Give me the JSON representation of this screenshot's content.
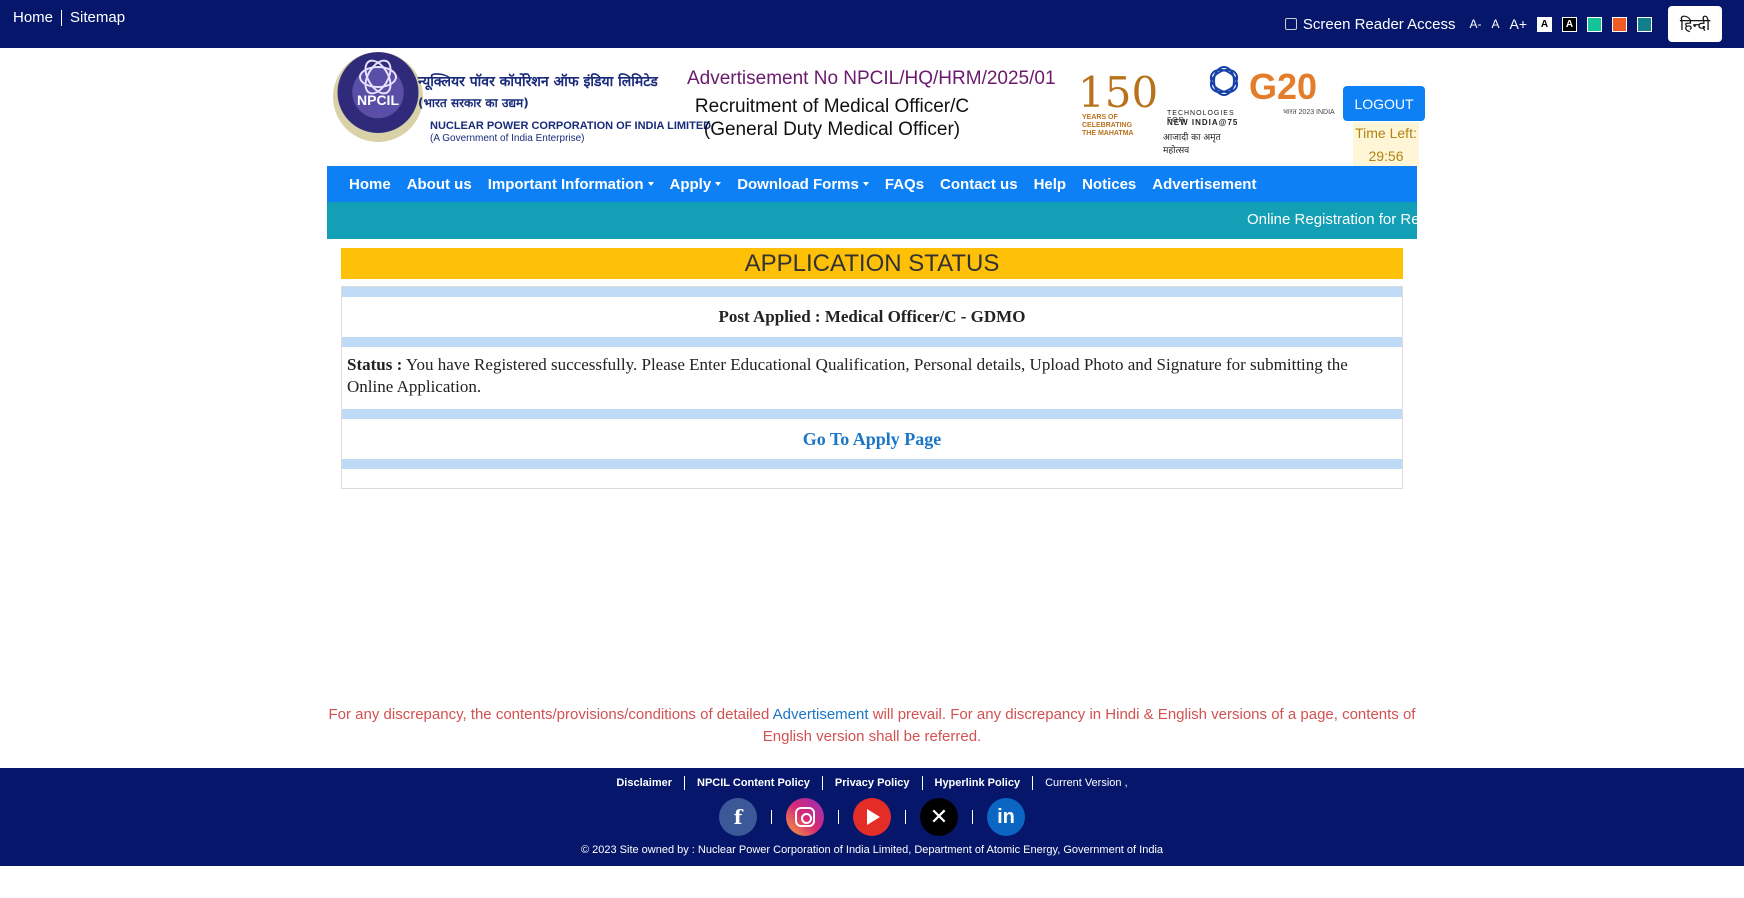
{
  "topbar": {
    "home": "Home",
    "sitemap": "Sitemap",
    "screen_reader": "Screen Reader Access",
    "font_decrease": "A-",
    "font_normal": "A",
    "font_increase": "A+",
    "contrast_white": "A",
    "contrast_black": "A",
    "theme_colors": [
      "#15c39a",
      "#f15a24",
      "#137f8c"
    ],
    "language": "हिन्दी"
  },
  "header": {
    "org_hindi": "न्यूक्लियर पॉवर कॉर्पोरेशन ऑफ इंडिया लिमिटेड",
    "org_hindi_sub": "(भारत सरकार का उद्यम)",
    "org_english": "NUCLEAR POWER CORPORATION OF INDIA LIMITED",
    "org_english_sub": "(A Government of India Enterprise)",
    "logo_text": "NPCIL",
    "advertisement_no": "Advertisement No NPCIL/HQ/HRM/2025/01",
    "recruitment_title": "Recruitment of Medical Officer/C (General Duty Medical Officer)",
    "badge150_number": "150",
    "badge150_text": "YEARS OF CELEBRATING THE MAHATMA",
    "tech_line1": "TECHNOLOGIES FOR",
    "tech_line2": "NEW INDIA@75",
    "tech_line3": "आजादी का अमृत महोत्सव",
    "g20_text": "G20",
    "g20_sub": "भारत 2023 INDIA",
    "logout": "LOGOUT",
    "time_left_label": "Time Left:",
    "time_left_value": "29:56"
  },
  "nav": {
    "items": [
      {
        "label": "Home",
        "dropdown": false
      },
      {
        "label": "About us",
        "dropdown": false
      },
      {
        "label": "Important Information",
        "dropdown": true
      },
      {
        "label": "Apply",
        "dropdown": true
      },
      {
        "label": "Download Forms",
        "dropdown": true
      },
      {
        "label": "FAQs",
        "dropdown": false
      },
      {
        "label": "Contact us",
        "dropdown": false
      },
      {
        "label": "Help",
        "dropdown": false
      },
      {
        "label": "Notices",
        "dropdown": false
      },
      {
        "label": "Advertisement",
        "dropdown": false
      }
    ]
  },
  "ticker": {
    "text": "Online Registration for Re"
  },
  "status": {
    "heading": "APPLICATION STATUS",
    "post_applied": "Post Applied : Medical Officer/C - GDMO",
    "status_label": "Status :",
    "status_text": "You have Registered successfully. Please Enter Educational Qualification, Personal details, Upload Photo and Signature for submitting the Online Application.",
    "go_apply": "Go To Apply Page"
  },
  "disclaimer": {
    "part1": "For any discrepancy, the contents/provisions/conditions of detailed ",
    "link": "Advertisement",
    "part2": " will prevail. For any discrepancy in Hindi & English versions of a page, contents of English version shall be referred."
  },
  "footer": {
    "links": [
      "Disclaimer",
      "NPCIL Content Policy",
      "Privacy Policy",
      "Hyperlink Policy"
    ],
    "version": "Current Version ,",
    "copyright": "© 2023 Site owned by : Nuclear Power Corporation of India Limited, Department of Atomic Energy, Government of India",
    "social": [
      "facebook",
      "instagram",
      "youtube",
      "x",
      "linkedin"
    ]
  }
}
